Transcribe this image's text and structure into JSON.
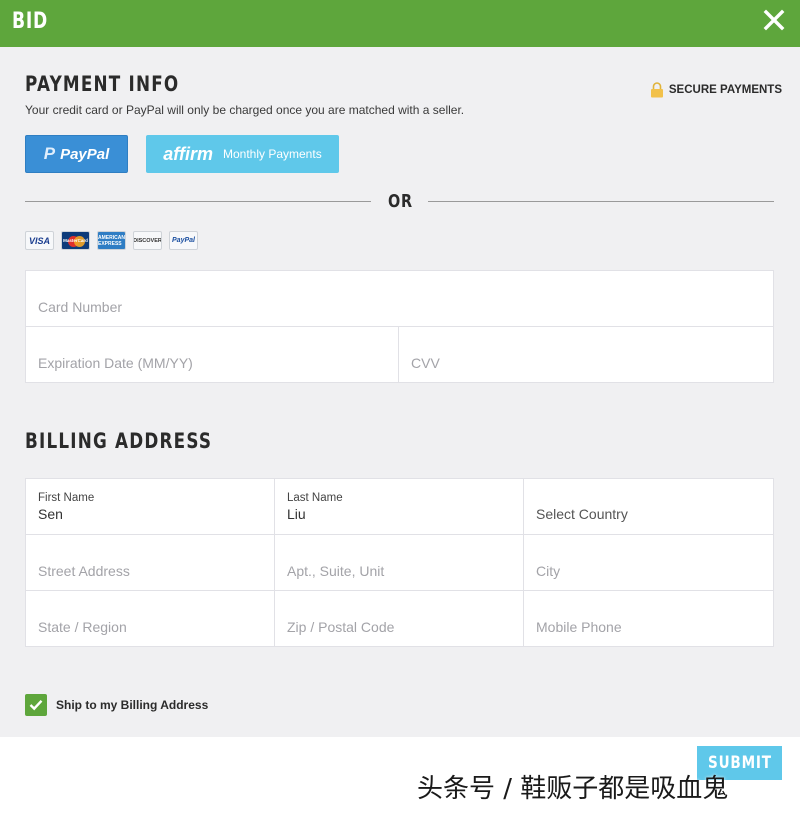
{
  "header": {
    "title": "BID"
  },
  "payment": {
    "title": "PAYMENT INFO",
    "subtitle": "Your credit card or PayPal will only be charged once you are matched with a seller.",
    "secure_label": "SECURE PAYMENTS",
    "paypal_button": "PayPal",
    "affirm_logo": "affirm",
    "affirm_button": "Monthly Payments",
    "or_text": "OR",
    "card_logos": [
      "VISA",
      "MasterCard",
      "AMERICAN EXPRESS",
      "DISCOVER",
      "PayPal"
    ],
    "card_number_placeholder": "Card Number",
    "expiration_placeholder": "Expiration Date (MM/YY)",
    "cvv_placeholder": "CVV"
  },
  "billing": {
    "title": "BILLING ADDRESS",
    "first_name_label": "First Name",
    "first_name_value": "Sen",
    "last_name_label": "Last Name",
    "last_name_value": "Liu",
    "country_select": "Select Country",
    "street_placeholder": "Street Address",
    "apt_placeholder": "Apt., Suite, Unit",
    "city_placeholder": "City",
    "state_placeholder": "State / Region",
    "zip_placeholder": "Zip / Postal Code",
    "phone_placeholder": "Mobile Phone"
  },
  "ship": {
    "label": "Ship to my Billing Address",
    "checked": true
  },
  "footer": {
    "submit_label": "SUBMIT"
  },
  "watermark": {
    "text": "头条号 / 鞋贩子都是吸血鬼"
  },
  "colors": {
    "header_green": "#5ea63c",
    "paypal_blue": "#3a8fd6",
    "affirm_cyan": "#5fc8ea",
    "background": "#f0f0f2"
  }
}
